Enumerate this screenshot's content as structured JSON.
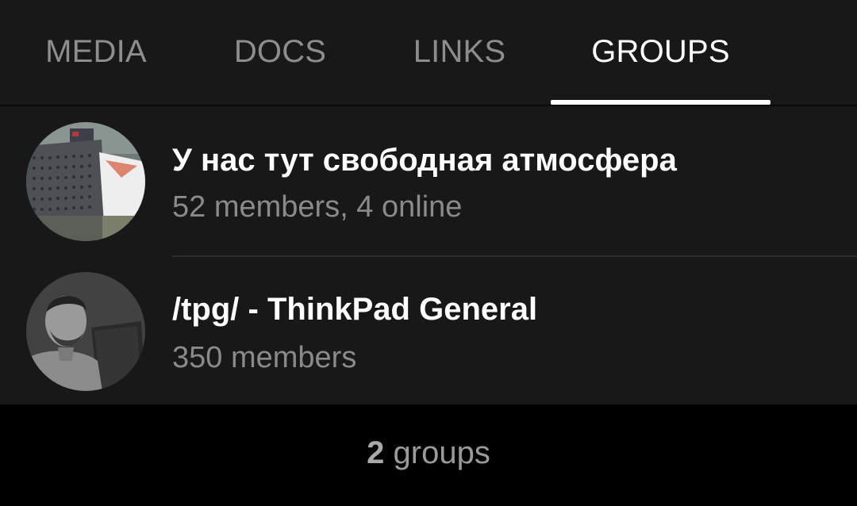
{
  "tabs": [
    {
      "label": "MEDIA",
      "active": false
    },
    {
      "label": "DOCS",
      "active": false
    },
    {
      "label": "LINKS",
      "active": false
    },
    {
      "label": "GROUPS",
      "active": true
    }
  ],
  "groups": [
    {
      "title": "У нас тут свободная атмосфера",
      "subtitle": "52 members, 4 online",
      "avatar_icon": "netbsd-case-photo"
    },
    {
      "title": "/tpg/ - ThinkPad General",
      "subtitle": "350 members",
      "avatar_icon": "man-with-laptop-photo"
    }
  ],
  "footer": {
    "count": "2",
    "label": " groups"
  },
  "colors": {
    "background": "#000000",
    "panel": "#181818",
    "active_tab": "#ffffff",
    "inactive_tab": "#8d8d8d",
    "subtitle": "#8a8a8a"
  }
}
